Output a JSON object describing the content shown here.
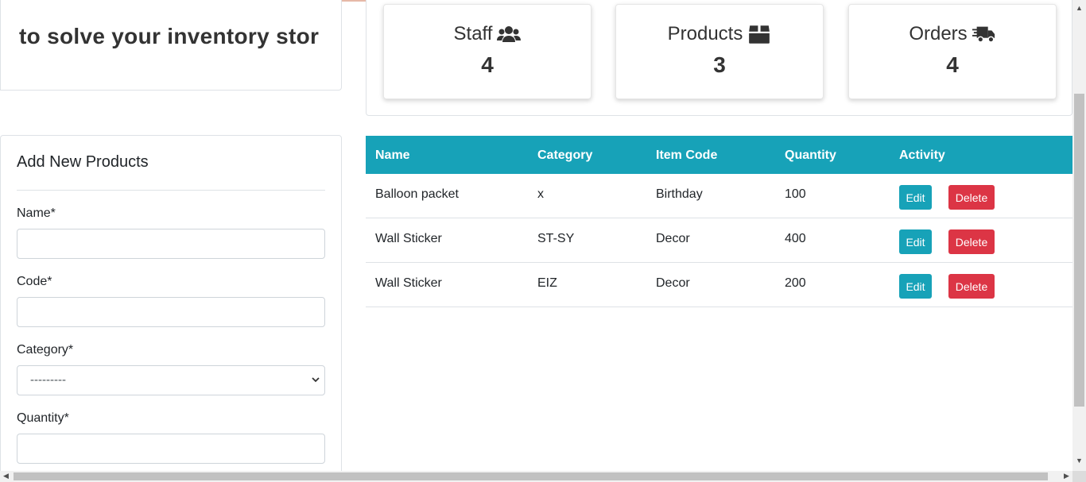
{
  "banner": {
    "marquee_text": "ere to solve your inventory stor"
  },
  "stats": [
    {
      "title": "Staff",
      "value": "4",
      "icon": "users-icon"
    },
    {
      "title": "Products",
      "value": "3",
      "icon": "box-icon"
    },
    {
      "title": "Orders",
      "value": "4",
      "icon": "shipping-fast-icon"
    }
  ],
  "form": {
    "title": "Add New Products",
    "name_label": "Name*",
    "name_value": "",
    "code_label": "Code*",
    "code_value": "",
    "category_label": "Category*",
    "category_selected": "---------",
    "quantity_label": "Quantity*",
    "quantity_value": ""
  },
  "table": {
    "headers": [
      "Name",
      "Category",
      "Item Code",
      "Quantity",
      "Activity"
    ],
    "rows": [
      {
        "name": "Balloon packet",
        "category": "x",
        "item_code": "Birthday",
        "quantity": "100"
      },
      {
        "name": "Wall Sticker",
        "category": "ST-SY",
        "item_code": "Decor",
        "quantity": "400"
      },
      {
        "name": "Wall Sticker",
        "category": "EIZ",
        "item_code": "Decor",
        "quantity": "200"
      }
    ],
    "edit_label": "Edit",
    "delete_label": "Delete"
  },
  "colors": {
    "header_bg": "#17a2b8",
    "edit_bg": "#17a2b8",
    "delete_bg": "#dc3545"
  }
}
